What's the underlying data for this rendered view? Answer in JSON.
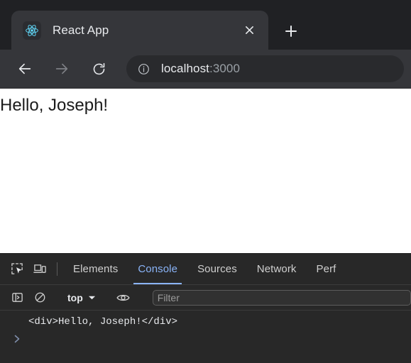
{
  "browser": {
    "tab": {
      "title": "React App",
      "favicon_icon": "react-logo-icon",
      "close_icon": "close-icon"
    },
    "new_tab": {
      "icon": "plus-icon",
      "tooltip": "New tab"
    },
    "nav": {
      "back_icon": "arrow-left-icon",
      "forward_icon": "arrow-right-icon",
      "reload_icon": "reload-icon"
    },
    "omnibox": {
      "info_icon": "info-circle-icon",
      "url_host": "localhost",
      "url_port": ":3000"
    }
  },
  "page": {
    "heading": "Hello, Joseph!"
  },
  "devtools": {
    "inspect_icon": "inspect-element-icon",
    "device_toolbar_icon": "device-toggle-icon",
    "tabs": [
      {
        "label": "Elements",
        "active": false
      },
      {
        "label": "Console",
        "active": true
      },
      {
        "label": "Sources",
        "active": false
      },
      {
        "label": "Network",
        "active": false
      },
      {
        "label": "Perf",
        "active": false
      }
    ],
    "console_toolbar": {
      "sidebar_icon": "console-sidebar-icon",
      "clear_icon": "clear-console-icon",
      "context": "top",
      "context_caret_icon": "chevron-down-icon",
      "eye_icon": "live-expression-eye-icon",
      "filter_placeholder": "Filter"
    },
    "console_output": [
      {
        "text": "<div>Hello, Joseph!</div>"
      }
    ],
    "prompt_icon": "chevron-right-icon"
  },
  "colors": {
    "chrome_bg": "#202124",
    "tab_active_bg": "#35363a",
    "omnibox_bg": "#292a2d",
    "page_bg": "#ffffff",
    "devtools_bg": "#282828",
    "accent_blue": "#8ab4f8",
    "react_cyan": "#61dafb"
  }
}
